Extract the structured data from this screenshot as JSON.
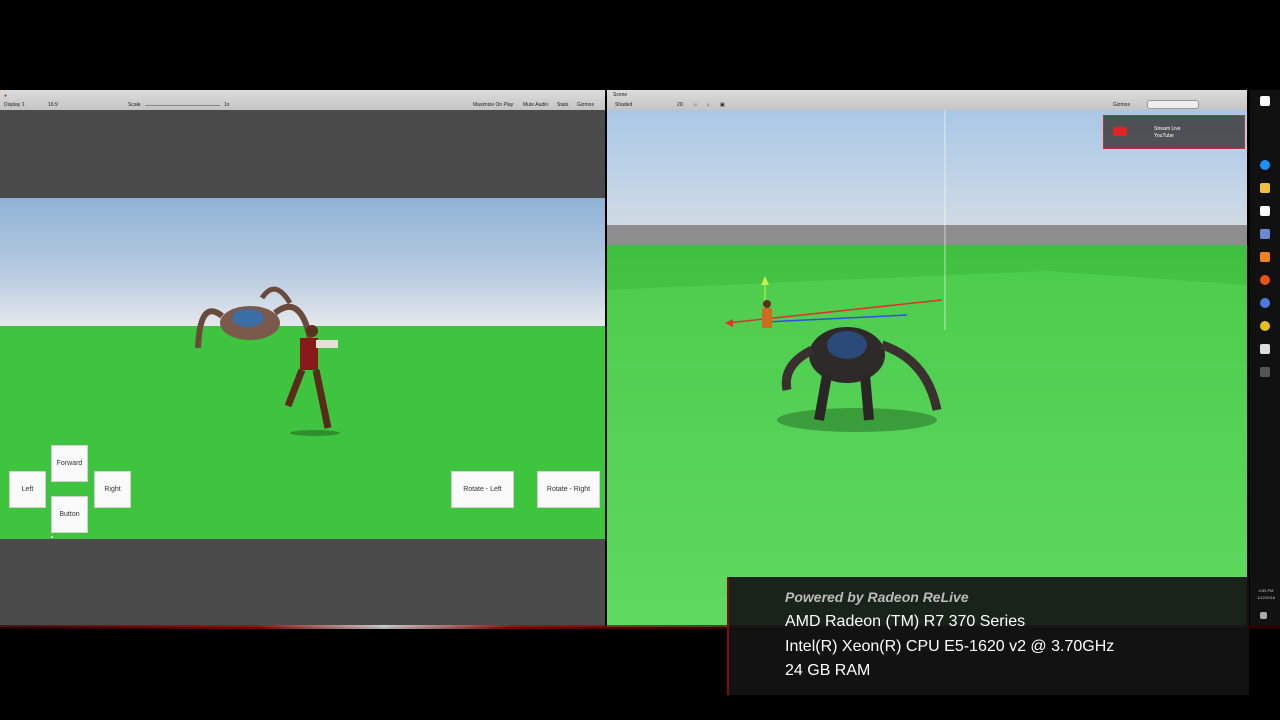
{
  "game_view": {
    "toolbar": {
      "display": "Display 1",
      "aspect": "16:9",
      "scale_label": "Scale",
      "scale_value": "1x",
      "maximize": "Maximize On Play",
      "mute": "Mute Audio",
      "stats": "Stats",
      "gizmos": "Gizmos"
    },
    "buttons": {
      "forward": "Forward",
      "left": "Left",
      "right": "Right",
      "button": "Button",
      "rotate_left": "Rotate - Left",
      "rotate_right": "Rotate - Right"
    }
  },
  "scene_view": {
    "toolbar": {
      "tab": "Scene",
      "shading": "Shaded",
      "mode_2d": "2D",
      "gizmos": "Gizmos"
    },
    "stream_badge": {
      "line1": "Stream Live",
      "line2": "YouTube"
    }
  },
  "overlay": {
    "powered_by": "Powered by Radeon ReLive",
    "gpu": "AMD Radeon (TM) R7 370 Series",
    "cpu": "Intel(R) Xeon(R) CPU E5-1620 v2 @ 3.70GHz",
    "ram": "24 GB RAM"
  },
  "taskbar": {
    "time": "4:53 PM",
    "date": "1/12/2018"
  },
  "colors": {
    "ground_green": "#3fc43f",
    "overlay_bg": "#141414",
    "record_red": "#e02424"
  }
}
